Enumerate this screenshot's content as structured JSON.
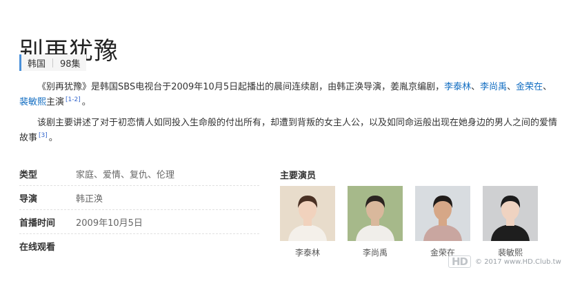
{
  "title": "别再犹豫",
  "meta": {
    "country": "韩国",
    "episodes": "98集"
  },
  "paragraph1": {
    "intro": "《别再犹豫》是韩国SBS电视台于2009年10月5日起播出的晨间连续剧，由韩正涣导演，姜胤京编剧，",
    "actors": [
      "李泰林",
      "李尚禹",
      "金荣在",
      "裴敏熙"
    ],
    "separator": "、",
    "suffix": "主演",
    "ref": "[1-2]",
    "end": "。"
  },
  "paragraph2": {
    "text": "该剧主要讲述了对于初恋情人如同投入生命般的付出所有，却遭到背叛的女主人公，以及如同命运般出现在她身边的男人之间的爱情故事",
    "ref": "[3]",
    "end": "。"
  },
  "info": [
    {
      "label": "类型",
      "value": "家庭、爱情、复仇、伦理"
    },
    {
      "label": "导演",
      "value": "韩正涣"
    },
    {
      "label": "首播时间",
      "value": "2009年10月5日"
    },
    {
      "label": "在线观看",
      "value": ""
    }
  ],
  "cast_title": "主要演员",
  "cast": [
    {
      "name": "李泰林",
      "bg": "#e8dccb",
      "skin": "#f1d2bd",
      "hair": "#4a3124",
      "cloth": "#f4f0ea"
    },
    {
      "name": "李尚禹",
      "bg": "#a6b98a",
      "skin": "#d9b89c",
      "hair": "#2b2420",
      "cloth": "#f0eeea"
    },
    {
      "name": "金荣在",
      "bg": "#d8dce0",
      "skin": "#d6a787",
      "hair": "#211c1a",
      "cloth": "#c9a6a0"
    },
    {
      "name": "裴敏熙",
      "bg": "#cfd0d2",
      "skin": "#efd3c1",
      "hair": "#1c1c1c",
      "cloth": "#1e1e1e"
    }
  ],
  "watermark": {
    "logo": "HD",
    "text": "© 2017 www.HD.Club.tw"
  }
}
